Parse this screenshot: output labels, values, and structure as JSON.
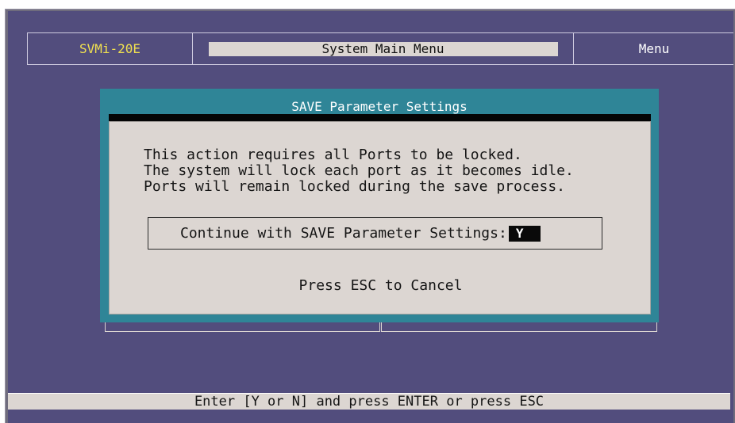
{
  "header": {
    "product": "SVMi-20E",
    "title": "System Main Menu",
    "mode": "Menu"
  },
  "dialog": {
    "title": "SAVE Parameter Settings",
    "message_lines": [
      "This action requires all Ports to be locked.",
      "The system will lock each port as it becomes idle.",
      "Ports will remain locked during the save process."
    ],
    "prompt_label": "Continue with SAVE Parameter Settings:",
    "prompt_value": "Y",
    "cancel_hint": "Press ESC to Cancel"
  },
  "status_bar": {
    "text": "Enter [Y or N] and press ENTER or press ESC"
  },
  "colors": {
    "screen_background": "#524d7d",
    "dialog_frame": "#2f8597",
    "dialog_body": "#dcd6d2",
    "product_label": "#f0e050"
  }
}
